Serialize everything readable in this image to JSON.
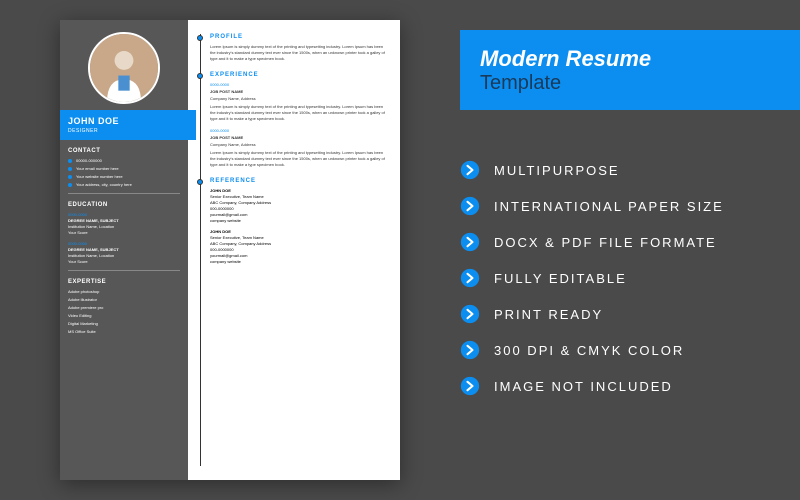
{
  "promo": {
    "title1": "Modern Resume",
    "title2": "Template"
  },
  "features": [
    "MULTIPURPOSE",
    "INTERNATIONAL PAPER SIZE",
    "DOCX & PDF FILE FORMATE",
    "FULLY EDITABLE",
    "PRINT READY",
    "300 DPI & CMYK COLOR",
    "IMAGE NOT INCLUDED"
  ],
  "sidebar": {
    "name": "JOHN DOE",
    "role": "DESIGNER",
    "contact": {
      "hdr": "CONTACT",
      "items": [
        "00000-000000",
        "Your email number here",
        "Your website number here",
        "Your address, city, country here"
      ]
    },
    "education": {
      "hdr": "EDUCATION",
      "items": [
        {
          "dates": "0000-0000",
          "degree": "DEGREE NAME, SUBJECT",
          "inst": "Institution Name, Location",
          "score": "Your Score"
        },
        {
          "dates": "0000-0000",
          "degree": "DEGREE NAME, SUBJECT",
          "inst": "Institution Name, Location",
          "score": "Your Score"
        }
      ]
    },
    "expertise": {
      "hdr": "EXPERTISE",
      "items": [
        "Adobe photoshop",
        "Adobe illustrator",
        "Adobe premiere pro",
        "Video Editing",
        "Digital Marketing",
        "MS Office Suite"
      ]
    }
  },
  "main": {
    "profile": {
      "hdr": "PROFILE",
      "body": "Lorem Ipsum is simply dummy text of the printing and typesetting industry. Lorem Ipsum has been the industry's standard dummy text ever since the 1500s, when an unknown printer took a galley of type and it to make a type specimen book."
    },
    "experience": {
      "hdr": "EXPERIENCE",
      "items": [
        {
          "dates": "0000-0000",
          "title": "JOB POST NAME",
          "company": "Company Name, Address",
          "body": "Lorem Ipsum is simply dummy text of the printing and typesetting industry. Lorem Ipsum has been the industry's standard dummy text ever since the 1500s, when an unknown printer took a galley of type and it to make a type specimen book."
        },
        {
          "dates": "0000-0000",
          "title": "JOB POST NAME",
          "company": "Company Name, Address",
          "body": "Lorem Ipsum is simply dummy text of the printing and typesetting industry. Lorem Ipsum has been the industry's standard dummy text ever since the 1500s, when an unknown printer took a galley of type and it to make a type specimen book."
        }
      ]
    },
    "reference": {
      "hdr": "REFERENCE",
      "items": [
        {
          "name": "JOHN DOE",
          "role": "Senior Executive, Team Name",
          "company": "ABC Company, Company Address",
          "phone": "000-0000000",
          "email": "yourmail@gmail.com",
          "web": "company website"
        },
        {
          "name": "JOHN DOE",
          "role": "Senior Executive, Team Name",
          "company": "ABC Company, Company Address",
          "phone": "000-0000000",
          "email": "yourmail@gmail.com",
          "web": "company website"
        }
      ]
    }
  }
}
